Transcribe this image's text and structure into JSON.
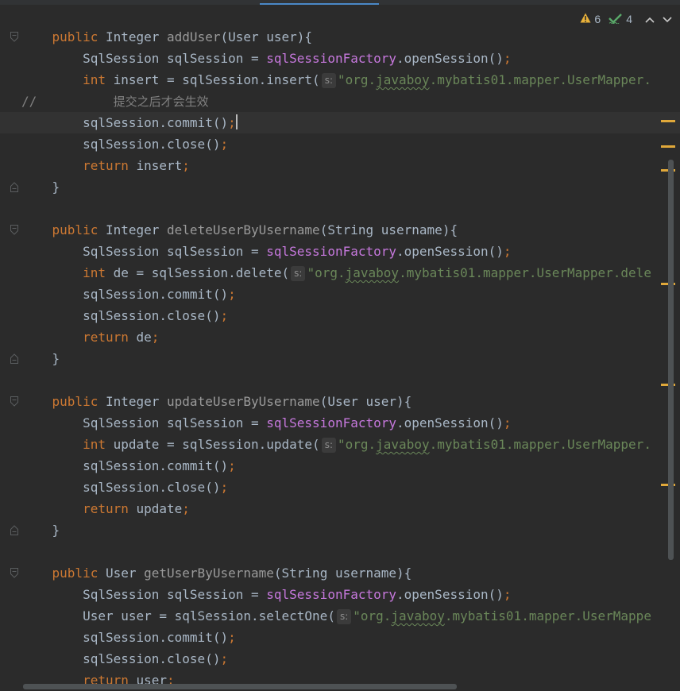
{
  "inspections": {
    "warning_count": "6",
    "weak_warning_count": "4",
    "colors": {
      "warning": "#e8b13a",
      "ok": "#59a869"
    }
  },
  "param_hint": "s:",
  "lines": [
    {
      "fold": "start",
      "tokens": [
        {
          "t": "    "
        },
        {
          "t": "public",
          "c": "kw"
        },
        {
          "t": " Integer "
        },
        {
          "t": "addUser",
          "c": "fn-grey"
        },
        {
          "t": "(User user){"
        }
      ]
    },
    {
      "tokens": [
        {
          "t": "        SqlSession sqlSession = "
        },
        {
          "t": "sqlSessionFactory",
          "c": "field"
        },
        {
          "t": ".openSession()"
        },
        {
          "t": ";",
          "c": "kw"
        }
      ]
    },
    {
      "tokens": [
        {
          "t": "        "
        },
        {
          "t": "int",
          "c": "kw"
        },
        {
          "t": " insert = sqlSession.insert("
        },
        {
          "hint": true
        },
        {
          "t": "\"org.",
          "c": "str"
        },
        {
          "t": "javaboy",
          "c": "str squig"
        },
        {
          "t": ".mybatis01.mapper.UserMapper.",
          "c": "str"
        }
      ]
    },
    {
      "tokens": [
        {
          "t": "//",
          "c": "comment"
        },
        {
          "t": "          "
        },
        {
          "t": "提交之后才会生效",
          "c": "cjk"
        }
      ]
    },
    {
      "current": true,
      "tokens": [
        {
          "t": "        sqlSession.commit()"
        },
        {
          "t": ";",
          "c": "kw"
        },
        {
          "caret": true
        }
      ]
    },
    {
      "tokens": [
        {
          "t": "        sqlSession.close()"
        },
        {
          "t": ";",
          "c": "kw"
        }
      ]
    },
    {
      "tokens": [
        {
          "t": "        "
        },
        {
          "t": "return",
          "c": "kw"
        },
        {
          "t": " insert"
        },
        {
          "t": ";",
          "c": "kw"
        }
      ]
    },
    {
      "fold": "end",
      "tokens": [
        {
          "t": "    }"
        }
      ]
    },
    {
      "tokens": []
    },
    {
      "fold": "start",
      "tokens": [
        {
          "t": "    "
        },
        {
          "t": "public",
          "c": "kw"
        },
        {
          "t": " Integer "
        },
        {
          "t": "deleteUserByUsername",
          "c": "fn-grey"
        },
        {
          "t": "(String username){"
        }
      ]
    },
    {
      "tokens": [
        {
          "t": "        SqlSession sqlSession = "
        },
        {
          "t": "sqlSessionFactory",
          "c": "field"
        },
        {
          "t": ".openSession()"
        },
        {
          "t": ";",
          "c": "kw"
        }
      ]
    },
    {
      "tokens": [
        {
          "t": "        "
        },
        {
          "t": "int",
          "c": "kw"
        },
        {
          "t": " de = sqlSession.delete("
        },
        {
          "hint": true
        },
        {
          "t": "\"org.",
          "c": "str"
        },
        {
          "t": "javaboy",
          "c": "str squig"
        },
        {
          "t": ".mybatis01.mapper.UserMapper.dele",
          "c": "str"
        }
      ]
    },
    {
      "tokens": [
        {
          "t": "        sqlSession.commit()"
        },
        {
          "t": ";",
          "c": "kw"
        }
      ]
    },
    {
      "tokens": [
        {
          "t": "        sqlSession.close()"
        },
        {
          "t": ";",
          "c": "kw"
        }
      ]
    },
    {
      "tokens": [
        {
          "t": "        "
        },
        {
          "t": "return",
          "c": "kw"
        },
        {
          "t": " de"
        },
        {
          "t": ";",
          "c": "kw"
        }
      ]
    },
    {
      "fold": "end",
      "tokens": [
        {
          "t": "    }"
        }
      ]
    },
    {
      "tokens": []
    },
    {
      "fold": "start",
      "tokens": [
        {
          "t": "    "
        },
        {
          "t": "public",
          "c": "kw"
        },
        {
          "t": " Integer "
        },
        {
          "t": "updateUserByUsername",
          "c": "fn-grey"
        },
        {
          "t": "(User user){"
        }
      ]
    },
    {
      "tokens": [
        {
          "t": "        SqlSession sqlSession = "
        },
        {
          "t": "sqlSessionFactory",
          "c": "field"
        },
        {
          "t": ".openSession()"
        },
        {
          "t": ";",
          "c": "kw"
        }
      ]
    },
    {
      "tokens": [
        {
          "t": "        "
        },
        {
          "t": "int",
          "c": "kw"
        },
        {
          "t": " update = sqlSession.update("
        },
        {
          "hint": true
        },
        {
          "t": "\"org.",
          "c": "str"
        },
        {
          "t": "javaboy",
          "c": "str squig"
        },
        {
          "t": ".mybatis01.mapper.UserMapper.",
          "c": "str"
        }
      ]
    },
    {
      "tokens": [
        {
          "t": "        sqlSession.commit()"
        },
        {
          "t": ";",
          "c": "kw"
        }
      ]
    },
    {
      "tokens": [
        {
          "t": "        sqlSession.close()"
        },
        {
          "t": ";",
          "c": "kw"
        }
      ]
    },
    {
      "tokens": [
        {
          "t": "        "
        },
        {
          "t": "return",
          "c": "kw"
        },
        {
          "t": " update"
        },
        {
          "t": ";",
          "c": "kw"
        }
      ]
    },
    {
      "fold": "end",
      "tokens": [
        {
          "t": "    }"
        }
      ]
    },
    {
      "tokens": []
    },
    {
      "fold": "start",
      "tokens": [
        {
          "t": "    "
        },
        {
          "t": "public",
          "c": "kw"
        },
        {
          "t": " User "
        },
        {
          "t": "getUserByUsername",
          "c": "fn-grey"
        },
        {
          "t": "(String username){"
        }
      ]
    },
    {
      "tokens": [
        {
          "t": "        SqlSession sqlSession = "
        },
        {
          "t": "sqlSessionFactory",
          "c": "field"
        },
        {
          "t": ".openSession()"
        },
        {
          "t": ";",
          "c": "kw"
        }
      ]
    },
    {
      "tokens": [
        {
          "t": "        User user = sqlSession.selectOne("
        },
        {
          "hint": true
        },
        {
          "t": "\"org.",
          "c": "str"
        },
        {
          "t": "javaboy",
          "c": "str squig"
        },
        {
          "t": ".mybatis01.mapper.UserMappe",
          "c": "str"
        }
      ]
    },
    {
      "tokens": [
        {
          "t": "        sqlSession.commit()"
        },
        {
          "t": ";",
          "c": "kw"
        }
      ]
    },
    {
      "tokens": [
        {
          "t": "        sqlSession.close()"
        },
        {
          "t": ";",
          "c": "kw"
        }
      ]
    },
    {
      "tokens": [
        {
          "t": "        "
        },
        {
          "t": "return",
          "c": "kw"
        },
        {
          "t": " user"
        },
        {
          "t": ";",
          "c": "kw"
        }
      ]
    }
  ]
}
